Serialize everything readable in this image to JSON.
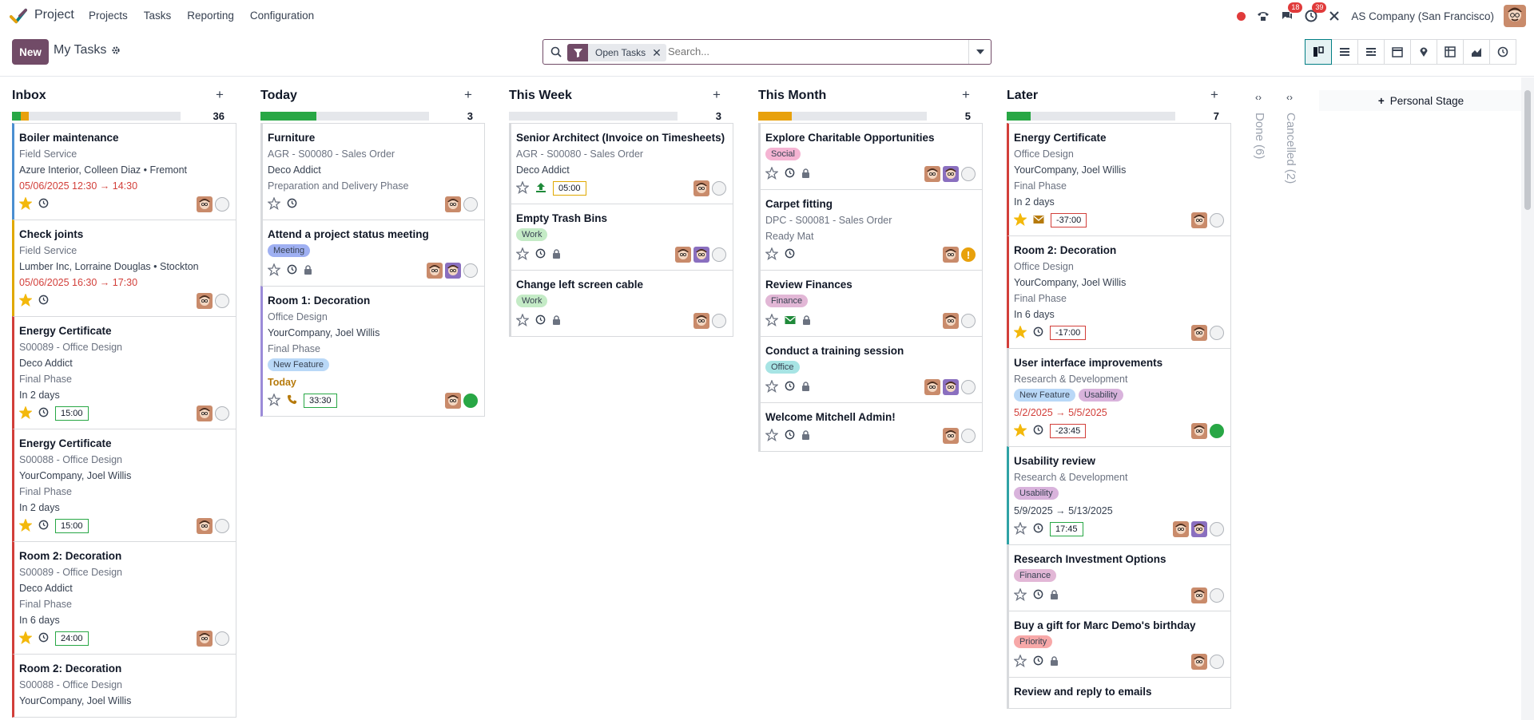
{
  "navbar": {
    "app_name": "Project",
    "menu": [
      "Projects",
      "Tasks",
      "Reporting",
      "Configuration"
    ],
    "messages_count": "18",
    "activities_count": "39",
    "company": "AS Company (San Francisco)"
  },
  "control": {
    "new_label": "New",
    "breadcrumb": "My Tasks",
    "facet_label": "Open Tasks",
    "search_placeholder": "Search...",
    "personal_stage": "Personal Stage"
  },
  "colors": {
    "primary": "#714b67",
    "accent": "#017e84",
    "green": "#28a745",
    "orange": "#e8a10c",
    "red": "#d23f3a"
  },
  "columns": [
    {
      "title": "Inbox",
      "count": "36",
      "progress": [
        {
          "color": "#28a745",
          "fraction": 0.05
        },
        {
          "color": "#e8a10c",
          "fraction": 0.05
        }
      ],
      "cards": [
        {
          "title": "Boiler maintenance",
          "border": "#4b8fd1",
          "lines": [
            {
              "t": "Field Service",
              "c": ""
            },
            {
              "t": "Azure Interior, Colleen Diaz • Fremont",
              "c": "dark"
            },
            {
              "t": "05/06/2025 12:30 → 14:30",
              "c": "red"
            }
          ],
          "tags": [],
          "star": true,
          "icon": "clock-icon",
          "time": null,
          "avatars": 1,
          "state": "normal"
        },
        {
          "title": "Check joints",
          "border": "#e0a800",
          "lines": [
            {
              "t": "Field Service",
              "c": ""
            },
            {
              "t": "Lumber Inc, Lorraine Douglas • Stockton",
              "c": "dark"
            },
            {
              "t": "05/06/2025 16:30 → 17:30",
              "c": "red"
            }
          ],
          "tags": [],
          "star": true,
          "icon": "clock-icon",
          "time": null,
          "avatars": 1,
          "state": "normal"
        },
        {
          "title": "Energy Certificate",
          "border": "#d23f3a",
          "lines": [
            {
              "t": "S00089 - Office Design",
              "c": ""
            },
            {
              "t": "Deco Addict",
              "c": "dark"
            },
            {
              "t": "Final Phase",
              "c": ""
            },
            {
              "t": "In 2 days",
              "c": "dark"
            }
          ],
          "tags": [],
          "star": true,
          "icon": "clock-icon",
          "time": "15:00",
          "time_color": "",
          "avatars": 1,
          "state": "normal"
        },
        {
          "title": "Energy Certificate",
          "border": "#d23f3a",
          "lines": [
            {
              "t": "S00088 - Office Design",
              "c": ""
            },
            {
              "t": "YourCompany, Joel Willis",
              "c": "dark"
            },
            {
              "t": "Final Phase",
              "c": ""
            },
            {
              "t": "In 2 days",
              "c": "dark"
            }
          ],
          "tags": [],
          "star": true,
          "icon": "clock-icon",
          "time": "15:00",
          "time_color": "",
          "avatars": 1,
          "state": "normal"
        },
        {
          "title": "Room 2: Decoration",
          "border": "#d23f3a",
          "lines": [
            {
              "t": "S00089 - Office Design",
              "c": ""
            },
            {
              "t": "Deco Addict",
              "c": "dark"
            },
            {
              "t": "Final Phase",
              "c": ""
            },
            {
              "t": "In 6 days",
              "c": "dark"
            }
          ],
          "tags": [],
          "star": true,
          "icon": "clock-icon",
          "time": "24:00",
          "time_color": "",
          "avatars": 1,
          "state": "normal"
        },
        {
          "title": "Room 2: Decoration",
          "border": "#d23f3a",
          "lines": [
            {
              "t": "S00088 - Office Design",
              "c": ""
            },
            {
              "t": "YourCompany, Joel Willis",
              "c": "dark"
            }
          ],
          "tags": [],
          "star": false,
          "icon": "",
          "time": null,
          "avatars": 0,
          "state": "none"
        }
      ]
    },
    {
      "title": "Today",
      "count": "3",
      "progress": [
        {
          "color": "#28a745",
          "fraction": 0.33
        }
      ],
      "cards": [
        {
          "title": "Furniture",
          "border": "#d8dadd",
          "lines": [
            {
              "t": "AGR - S00080 - Sales Order",
              "c": ""
            },
            {
              "t": "Deco Addict",
              "c": "dark"
            },
            {
              "t": "Preparation and Delivery Phase",
              "c": ""
            }
          ],
          "tags": [],
          "star": false,
          "icon": "clock-icon",
          "time": null,
          "avatars": 1,
          "state": "normal"
        },
        {
          "title": "Attend a project status meeting",
          "border": "#d8dadd",
          "lines": [],
          "tags": [
            {
              "t": "Meeting",
              "bg": "#9fb0f2"
            }
          ],
          "star": false,
          "icon": "clock-icon",
          "lock": true,
          "time": null,
          "avatars": 2,
          "state": "normal"
        },
        {
          "title": "Room 1: Decoration",
          "border": "#9b8bd8",
          "lines": [
            {
              "t": "Office Design",
              "c": ""
            },
            {
              "t": "YourCompany, Joel Willis",
              "c": "dark"
            },
            {
              "t": "Final Phase",
              "c": ""
            }
          ],
          "tags": [
            {
              "t": "New Feature",
              "bg": "#b9d8f7"
            }
          ],
          "after_line": {
            "t": "Today",
            "c": "today"
          },
          "star": false,
          "icon": "phone-icon",
          "time": "33:30",
          "time_color": "",
          "avatars": 1,
          "state": "green"
        }
      ]
    },
    {
      "title": "This Week",
      "count": "3",
      "progress": [],
      "cards": [
        {
          "title": "Senior Architect (Invoice on Timesheets)",
          "border": "#d8dadd",
          "lines": [
            {
              "t": "AGR - S00080 - Sales Order",
              "c": ""
            },
            {
              "t": "Deco Addict",
              "c": "dark"
            }
          ],
          "tags": [],
          "star": false,
          "icon": "upload-icon",
          "time": "05:00",
          "time_color": "orange",
          "avatars": 1,
          "state": "normal"
        },
        {
          "title": "Empty Trash Bins",
          "border": "#d8dadd",
          "lines": [],
          "tags": [
            {
              "t": "Work",
              "bg": "#c4ebc6"
            }
          ],
          "star": false,
          "icon": "clock-icon",
          "lock": true,
          "time": null,
          "avatars": 2,
          "state": "normal"
        },
        {
          "title": "Change left screen cable",
          "border": "#d8dadd",
          "lines": [],
          "tags": [
            {
              "t": "Work",
              "bg": "#c4ebc6"
            }
          ],
          "star": false,
          "icon": "clock-icon",
          "lock": true,
          "time": null,
          "avatars": 1,
          "state": "normal"
        }
      ]
    },
    {
      "title": "This Month",
      "count": "5",
      "progress": [
        {
          "color": "#e8a10c",
          "fraction": 0.2
        }
      ],
      "cards": [
        {
          "title": "Explore Charitable Opportunities",
          "border": "#d8dadd",
          "lines": [],
          "tags": [
            {
              "t": "Social",
              "bg": "#f5b4d3"
            }
          ],
          "star": false,
          "icon": "clock-icon",
          "lock": true,
          "time": null,
          "avatars": 2,
          "state": "normal"
        },
        {
          "title": "Carpet fitting",
          "border": "#d8dadd",
          "lines": [
            {
              "t": "DPC - S00081 - Sales Order",
              "c": ""
            },
            {
              "t": "Ready Mat",
              "c": ""
            }
          ],
          "tags": [],
          "star": false,
          "icon": "clock-icon",
          "time": null,
          "avatars": 1,
          "state": "warn"
        },
        {
          "title": "Review Finances",
          "border": "#d8dadd",
          "lines": [],
          "tags": [
            {
              "t": "Finance",
              "bg": "#e2b7d6"
            }
          ],
          "star": false,
          "icon": "mail-icon",
          "icon_color": "#1f8a3a",
          "lock": true,
          "time": null,
          "avatars": 1,
          "state": "normal"
        },
        {
          "title": "Conduct a training session",
          "border": "#d8dadd",
          "lines": [],
          "tags": [
            {
              "t": "Office",
              "bg": "#a7e4e4"
            }
          ],
          "star": false,
          "icon": "clock-icon",
          "lock": true,
          "time": null,
          "avatars": 2,
          "state": "normal"
        },
        {
          "title": "Welcome Mitchell Admin!",
          "border": "#d8dadd",
          "lines": [],
          "tags": [],
          "star": false,
          "icon": "clock-icon",
          "lock": true,
          "time": null,
          "avatars": 1,
          "state": "normal"
        }
      ]
    },
    {
      "title": "Later",
      "count": "7",
      "progress": [
        {
          "color": "#28a745",
          "fraction": 0.14
        }
      ],
      "cards": [
        {
          "title": "Energy Certificate",
          "border": "#d23f3a",
          "lines": [
            {
              "t": "Office Design",
              "c": ""
            },
            {
              "t": "YourCompany, Joel Willis",
              "c": "dark"
            },
            {
              "t": "Final Phase",
              "c": ""
            },
            {
              "t": "In 2 days",
              "c": "dark"
            }
          ],
          "tags": [],
          "star": true,
          "icon": "mail-icon",
          "icon_color": "#b67a0c",
          "time": "-37:00",
          "time_color": "red",
          "avatars": 1,
          "state": "normal"
        },
        {
          "title": "Room 2: Decoration",
          "border": "#d23f3a",
          "lines": [
            {
              "t": "Office Design",
              "c": ""
            },
            {
              "t": "YourCompany, Joel Willis",
              "c": "dark"
            },
            {
              "t": "Final Phase",
              "c": ""
            },
            {
              "t": "In 6 days",
              "c": "dark"
            }
          ],
          "tags": [],
          "star": true,
          "icon": "clock-icon",
          "time": "-17:00",
          "time_color": "red",
          "avatars": 1,
          "state": "normal"
        },
        {
          "title": "User interface improvements",
          "border": "#d8dadd",
          "lines": [
            {
              "t": "Research & Development",
              "c": ""
            }
          ],
          "tags": [
            {
              "t": "New Feature",
              "bg": "#b9d8f7"
            },
            {
              "t": "Usability",
              "bg": "#d9b3dc"
            }
          ],
          "after_line": {
            "t": "5/2/2025 → 5/5/2025",
            "c": "red"
          },
          "star": true,
          "icon": "clock-icon",
          "time": "-23:45",
          "time_color": "red",
          "avatars": 1,
          "state": "green"
        },
        {
          "title": "Usability review",
          "border": "#2fa3a6",
          "lines": [
            {
              "t": "Research & Development",
              "c": ""
            }
          ],
          "tags": [
            {
              "t": "Usability",
              "bg": "#d9b3dc"
            }
          ],
          "after_line": {
            "t": "5/9/2025 → 5/13/2025",
            "c": "dark"
          },
          "star": false,
          "icon": "clock-icon",
          "time": "17:45",
          "time_color": "",
          "avatars": 2,
          "state": "normal"
        },
        {
          "title": "Research Investment Options",
          "border": "#d8dadd",
          "lines": [],
          "tags": [
            {
              "t": "Finance",
              "bg": "#e2b7d6"
            }
          ],
          "star": false,
          "icon": "clock-icon",
          "lock": true,
          "time": null,
          "avatars": 1,
          "state": "normal"
        },
        {
          "title": "Buy a gift for Marc Demo's birthday",
          "border": "#d8dadd",
          "lines": [],
          "tags": [
            {
              "t": "Priority",
              "bg": "#f7a8a8"
            }
          ],
          "star": false,
          "icon": "clock-icon",
          "lock": true,
          "time": null,
          "avatars": 1,
          "state": "normal"
        },
        {
          "title": "Review and reply to emails",
          "border": "#d8dadd",
          "lines": [],
          "tags": [],
          "star": false,
          "icon": "",
          "time": null,
          "avatars": 0,
          "state": "none"
        }
      ]
    }
  ],
  "folded": [
    {
      "label": "Done (6)"
    },
    {
      "label": "Cancelled (2)"
    }
  ]
}
